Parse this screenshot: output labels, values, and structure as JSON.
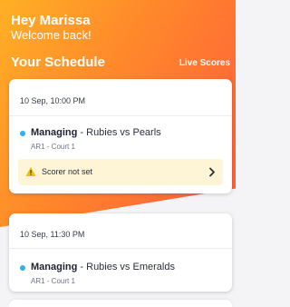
{
  "header": {
    "greeting": "Hey Marissa",
    "welcome": "Welcome back!"
  },
  "schedule": {
    "title": "Your Schedule",
    "live_scores_label": "Live Scores",
    "matches": [
      {
        "datetime": "10 Sep, 10:00 PM",
        "role": "Managing",
        "separator": " - ",
        "teams": "Rubies vs Pearls",
        "venue": "AR1 - Court 1",
        "status_icon": "dot-blue",
        "warning": {
          "icon": "warning-triangle-icon",
          "text": "Scorer not set",
          "action_icon": "chevron-right-icon"
        }
      },
      {
        "datetime": "10 Sep, 11:30 PM",
        "role": "Managing",
        "separator": " - ",
        "teams": "Rubies vs Emeralds",
        "venue": "AR1 - Court 1",
        "status_icon": "dot-blue"
      }
    ]
  },
  "colors": {
    "gradient_start": "#ffb026",
    "gradient_end": "#ff5a3c",
    "status_dot": "#2bb2ee",
    "warning_bg": "#fdf5d5",
    "warning_icon": "#f2c200"
  }
}
